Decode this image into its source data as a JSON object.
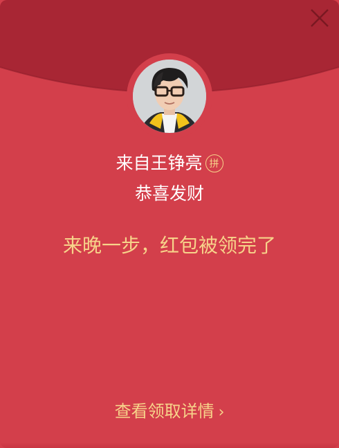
{
  "envelope": {
    "sender_name": "来自王铮亮",
    "pin_badge": "拼",
    "greeting": "恭喜发财",
    "message": "来晚一步，红包被领完了",
    "details_label": "查看领取详情",
    "details_chevron": "›"
  },
  "icons": {
    "close": "close-icon",
    "details": "chevron-right-icon"
  },
  "colors": {
    "envelope_red": "#d33f4b",
    "flap_red": "#a82634",
    "gold": "#f7d38a",
    "white": "#ffffff"
  }
}
